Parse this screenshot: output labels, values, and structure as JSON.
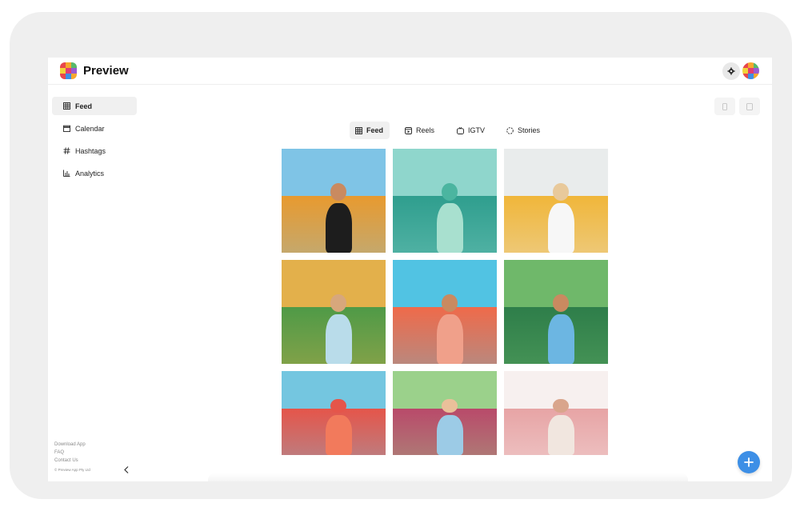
{
  "app": {
    "name": "Preview"
  },
  "logo_colors": [
    "#e8474c",
    "#f7a72d",
    "#58b96b",
    "#f2d33a",
    "#e23c73",
    "#9b5bd0",
    "#e8474c",
    "#3d8fe6",
    "#f7a72d"
  ],
  "sidebar": {
    "items": [
      {
        "label": "Feed",
        "icon": "grid-icon",
        "active": true
      },
      {
        "label": "Calendar",
        "icon": "calendar-icon",
        "active": false
      },
      {
        "label": "Hashtags",
        "icon": "hashtag-icon",
        "active": false
      },
      {
        "label": "Analytics",
        "icon": "bar-chart-icon",
        "active": false
      }
    ],
    "footer_links": [
      "Download App",
      "FAQ",
      "Contact Us"
    ],
    "copyright": "© Preview App Pty Ltd"
  },
  "tabs": [
    {
      "label": "Feed",
      "icon": "grid-icon",
      "active": true
    },
    {
      "label": "Reels",
      "icon": "reels-icon",
      "active": false
    },
    {
      "label": "IGTV",
      "icon": "tv-icon",
      "active": false
    },
    {
      "label": "Stories",
      "icon": "stories-circle-icon",
      "active": false
    }
  ],
  "toolbar": {
    "phone_view_icon": "phone-icon",
    "tablet_view_icon": "tablet-icon"
  },
  "accent_color": "#3d8fe6",
  "photos": [
    {
      "name": "sunflower-field-woman",
      "sky": "#7fc4e6",
      "ground": "#e89a2f",
      "subject": "#1d1d1d",
      "skin": "#c98a60"
    },
    {
      "name": "tropical-leaves",
      "sky": "#8fd6cc",
      "ground": "#2f9e8e",
      "subject": "#a8e0cf",
      "skin": "#4bb5a0"
    },
    {
      "name": "blonde-woman-field",
      "sky": "#e9ecec",
      "ground": "#f0b63a",
      "subject": "#f7f7f7",
      "skin": "#e8c99b"
    },
    {
      "name": "woman-crouching-greenery",
      "sky": "#e3b04b",
      "ground": "#4f9a47",
      "subject": "#b9dcea",
      "skin": "#d7a77c"
    },
    {
      "name": "woman-on-palm-trunk",
      "sky": "#51c3e3",
      "ground": "#ef6a4a",
      "subject": "#f0a08a",
      "skin": "#c98a60"
    },
    {
      "name": "woman-under-banana-trees",
      "sky": "#6fb86a",
      "ground": "#2e7e4a",
      "subject": "#6cb6e2",
      "skin": "#c98a60"
    },
    {
      "name": "flower-field-horizon",
      "sky": "#74c6e0",
      "ground": "#e5554a",
      "subject": "#f27a5c",
      "skin": "#e5554a"
    },
    {
      "name": "smiling-woman-denim",
      "sky": "#9bd18b",
      "ground": "#b94a6a",
      "subject": "#9ccbe6",
      "skin": "#eac09a"
    },
    {
      "name": "woman-ferris-wheel",
      "sky": "#f7f0ef",
      "ground": "#e7a4a5",
      "subject": "#f1e6df",
      "skin": "#d9a58c"
    }
  ]
}
